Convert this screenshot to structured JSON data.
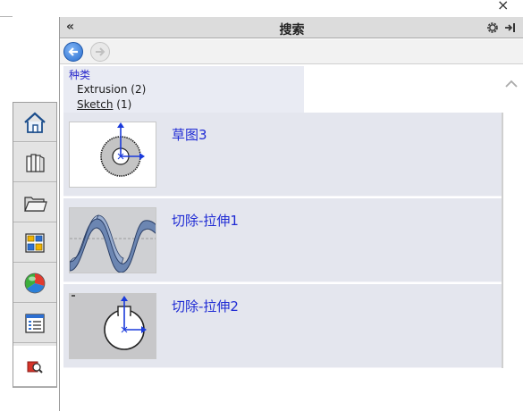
{
  "window": {
    "close_glyph": "×"
  },
  "pane": {
    "title": "搜索",
    "collapse_glyph": "«",
    "options_icon": "gear-icon",
    "pin_icon": "pin-icon"
  },
  "nav": {
    "back_icon": "arrow-left-icon",
    "forward_icon": "arrow-right-icon"
  },
  "categories": {
    "title": "种类",
    "items": [
      {
        "label": "Extrusion (2)",
        "link": false
      },
      {
        "label": "Sketch",
        "count": "(1)",
        "link": true
      }
    ]
  },
  "results": [
    {
      "label": "草图3",
      "thumbnail": "sketch-gear-thumbnail"
    },
    {
      "label": "切除-拉伸1",
      "thumbnail": "wave-surface-thumbnail"
    },
    {
      "label": "切除-拉伸2",
      "thumbnail": "keyed-circle-thumbnail"
    }
  ],
  "tabs": [
    {
      "icon": "home-icon"
    },
    {
      "icon": "design-library-icon"
    },
    {
      "icon": "file-explorer-icon"
    },
    {
      "icon": "view-palette-icon"
    },
    {
      "icon": "appearances-icon"
    },
    {
      "icon": "custom-properties-icon"
    },
    {
      "icon": "search-results-icon",
      "active": true
    }
  ],
  "colors": {
    "accent_link": "#1f2bd4",
    "result_bg": "#e4e6ee",
    "header_bg": "#dcdcdc"
  }
}
